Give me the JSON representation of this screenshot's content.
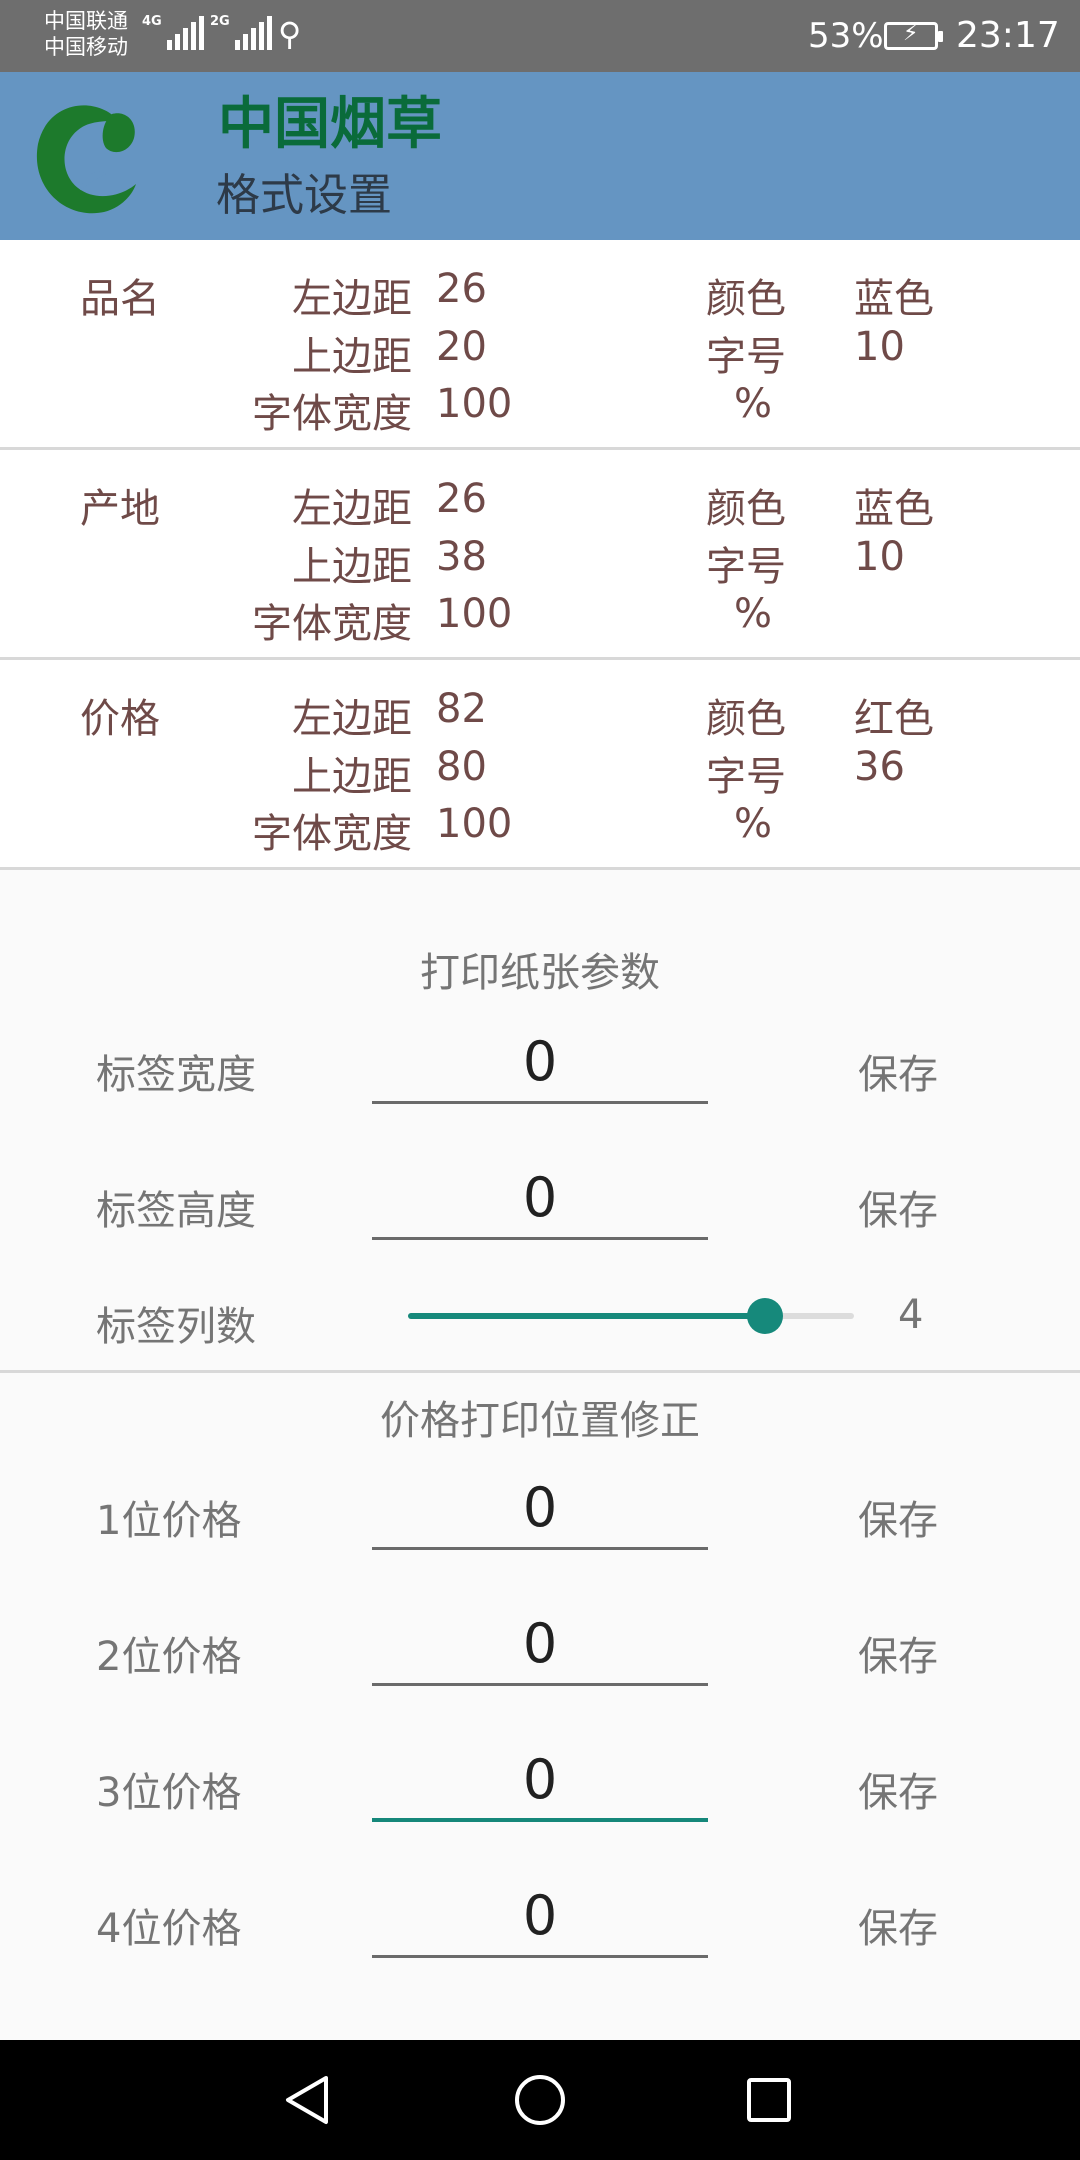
{
  "status_bar": {
    "carrier1": "中国联通",
    "carrier2": "中国移动",
    "net1": "4G",
    "net2": "2G",
    "battery": "53%",
    "time": "23:17"
  },
  "header": {
    "title": "中国烟草",
    "subtitle": "格式设置"
  },
  "format_sections": [
    {
      "name": "品名",
      "left_label": "左边距",
      "left": "26",
      "top_label": "上边距",
      "top": "20",
      "width_label": "字体宽度",
      "width": "100",
      "color_label": "颜色",
      "color": "蓝色",
      "size_label": "字号",
      "size": "10",
      "pct": "%"
    },
    {
      "name": "产地",
      "left_label": "左边距",
      "left": "26",
      "top_label": "上边距",
      "top": "38",
      "width_label": "字体宽度",
      "width": "100",
      "color_label": "颜色",
      "color": "蓝色",
      "size_label": "字号",
      "size": "10",
      "pct": "%"
    },
    {
      "name": "价格",
      "left_label": "左边距",
      "left": "82",
      "top_label": "上边距",
      "top": "80",
      "width_label": "字体宽度",
      "width": "100",
      "color_label": "颜色",
      "color": "红色",
      "size_label": "字号",
      "size": "36",
      "pct": "%"
    }
  ],
  "paper": {
    "title": "打印纸张参数",
    "label_width": {
      "label": "标签宽度",
      "value": "0",
      "save": "保存"
    },
    "label_height": {
      "label": "标签高度",
      "value": "0",
      "save": "保存"
    },
    "columns": {
      "label": "标签列数",
      "value": "4",
      "max": 5
    }
  },
  "price_fix": {
    "title": "价格打印位置修正",
    "rows": [
      {
        "label": "1位价格",
        "value": "0",
        "save": "保存"
      },
      {
        "label": "2位价格",
        "value": "0",
        "save": "保存"
      },
      {
        "label": "3位价格",
        "value": "0",
        "save": "保存"
      },
      {
        "label": "4位价格",
        "value": "0",
        "save": "保存"
      }
    ]
  },
  "colors": {
    "header_bg": "#6595c2",
    "accent": "#16897b",
    "title_green": "#0a6b3a"
  }
}
